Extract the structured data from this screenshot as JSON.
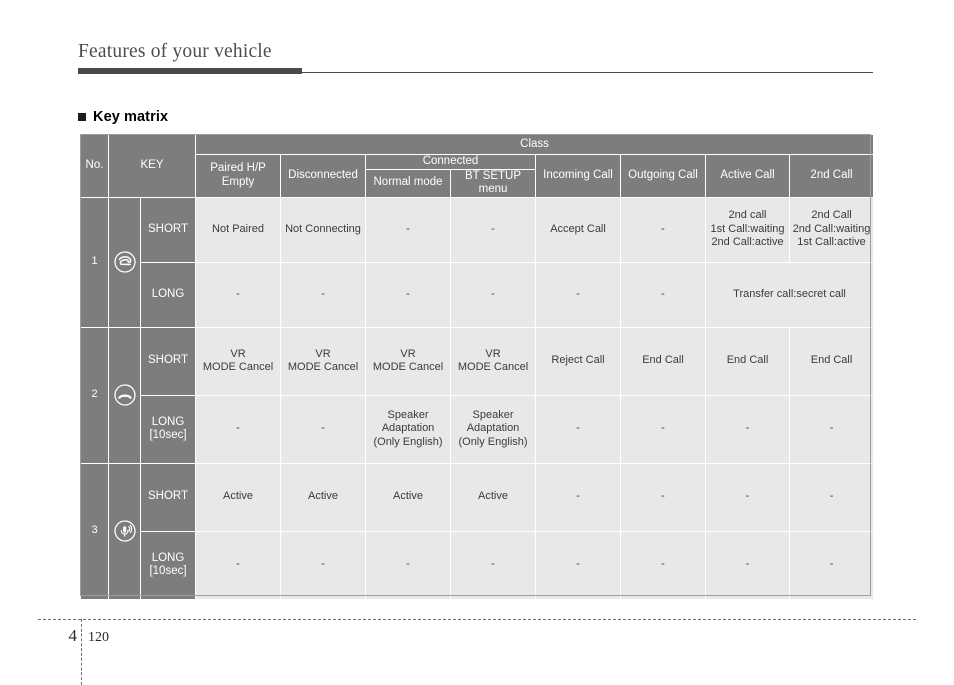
{
  "page": {
    "chapter_title": "Features of your vehicle",
    "section_heading": "Key matrix",
    "footer": {
      "chapter_number": "4",
      "page_number": "120"
    }
  },
  "table": {
    "header": {
      "no_label": "No.",
      "key_label": "KEY",
      "class_label": "Class",
      "columns": [
        "Paired H/P\nEmpty",
        "Disconnected",
        "Connected",
        "Incoming Call",
        "Outgoing Call",
        "Active Call",
        "2nd Call"
      ],
      "col_paired_line1": "Paired H/P",
      "col_paired_line2": "Empty",
      "col_disconnected": "Disconnected",
      "col_connected": "Connected",
      "col_normal_mode": "Normal mode",
      "col_bt_setup_menu": "BT SETUP menu",
      "col_incoming_call": "Incoming Call",
      "col_outgoing_call": "Outgoing Call",
      "col_active_call": "Active Call",
      "col_2nd_call": "2nd Call"
    },
    "rows": [
      {
        "no": "1",
        "icon": "call-answer-icon",
        "press_types": [
          {
            "label": "SHORT",
            "label_sub": "",
            "cells": [
              "Not Paired",
              "Not Connecting",
              "-",
              "-",
              "Accept Call",
              "-",
              "2nd call\n1st Call:waiting\n2nd Call:active",
              "2nd Call\n2nd Call:waiting\n1st Call:active"
            ]
          },
          {
            "label": "LONG",
            "label_sub": "",
            "cells": [
              "-",
              "-",
              "-",
              "-",
              "-",
              "-",
              "Transfer call:secret call"
            ]
          }
        ]
      },
      {
        "no": "2",
        "icon": "call-end-icon",
        "press_types": [
          {
            "label": "SHORT",
            "label_sub": "",
            "cells": [
              "VR\nMODE Cancel",
              "VR\nMODE Cancel",
              "VR\nMODE Cancel",
              "VR\nMODE Cancel",
              "Reject Call",
              "End Call",
              "End Call",
              "End Call"
            ]
          },
          {
            "label": "LONG",
            "label_sub": "[10sec]",
            "cells": [
              "-",
              "-",
              "Speaker\nAdaptation\n(Only English)",
              "Speaker\nAdaptation\n(Only English)",
              "-",
              "-",
              "-",
              "-"
            ]
          }
        ]
      },
      {
        "no": "3",
        "icon": "voice-recognition-icon",
        "press_types": [
          {
            "label": "SHORT",
            "label_sub": "",
            "cells": [
              "Active",
              "Active",
              "Active",
              "Active",
              "-",
              "-",
              "-",
              "-"
            ]
          },
          {
            "label": "LONG",
            "label_sub": "[10sec]",
            "cells": [
              "-",
              "-",
              "-",
              "-",
              "-",
              "-",
              "-",
              "-"
            ]
          }
        ]
      }
    ],
    "cells": {
      "r1_short": {
        "paired": "Not Paired",
        "disconnected": "Not Connecting",
        "normal": "-",
        "btsetup": "-",
        "incoming": "Accept Call",
        "outgoing": "-",
        "active_l1": "2nd call",
        "active_l2": "1st Call:waiting",
        "active_l3": "2nd Call:active",
        "second_l1": "2nd Call",
        "second_l2": "2nd Call:waiting",
        "second_l3": "1st Call:active"
      },
      "r1_long": {
        "paired": "-",
        "disconnected": "-",
        "normal": "-",
        "btsetup": "-",
        "incoming": "-",
        "outgoing": "-",
        "transfer": "Transfer call:secret call"
      },
      "r2_short": {
        "paired_l1": "VR",
        "paired_l2": "MODE Cancel",
        "disconnected_l1": "VR",
        "disconnected_l2": "MODE Cancel",
        "normal_l1": "VR",
        "normal_l2": "MODE Cancel",
        "btsetup_l1": "VR",
        "btsetup_l2": "MODE Cancel",
        "incoming": "Reject Call",
        "outgoing": "End Call",
        "active": "End Call",
        "second": "End Call"
      },
      "r2_long": {
        "paired": "-",
        "disconnected": "-",
        "normal_l1": "Speaker",
        "normal_l2": "Adaptation",
        "normal_l3": "(Only English)",
        "btsetup_l1": "Speaker",
        "btsetup_l2": "Adaptation",
        "btsetup_l3": "(Only English)",
        "incoming": "-",
        "outgoing": "-",
        "active": "-",
        "second": "-"
      },
      "r3_short": {
        "paired": "Active",
        "disconnected": "Active",
        "normal": "Active",
        "btsetup": "Active",
        "incoming": "-",
        "outgoing": "-",
        "active": "-",
        "second": "-"
      },
      "r3_long": {
        "paired": "-",
        "disconnected": "-",
        "normal": "-",
        "btsetup": "-",
        "incoming": "-",
        "outgoing": "-",
        "active": "-",
        "second": "-"
      }
    }
  },
  "colors": {
    "header_gray": "#7d7d7d",
    "cell_gray": "#e8e8e8",
    "rule_dark": "#4a4a4a",
    "text_dark": "#3b3b3b"
  }
}
